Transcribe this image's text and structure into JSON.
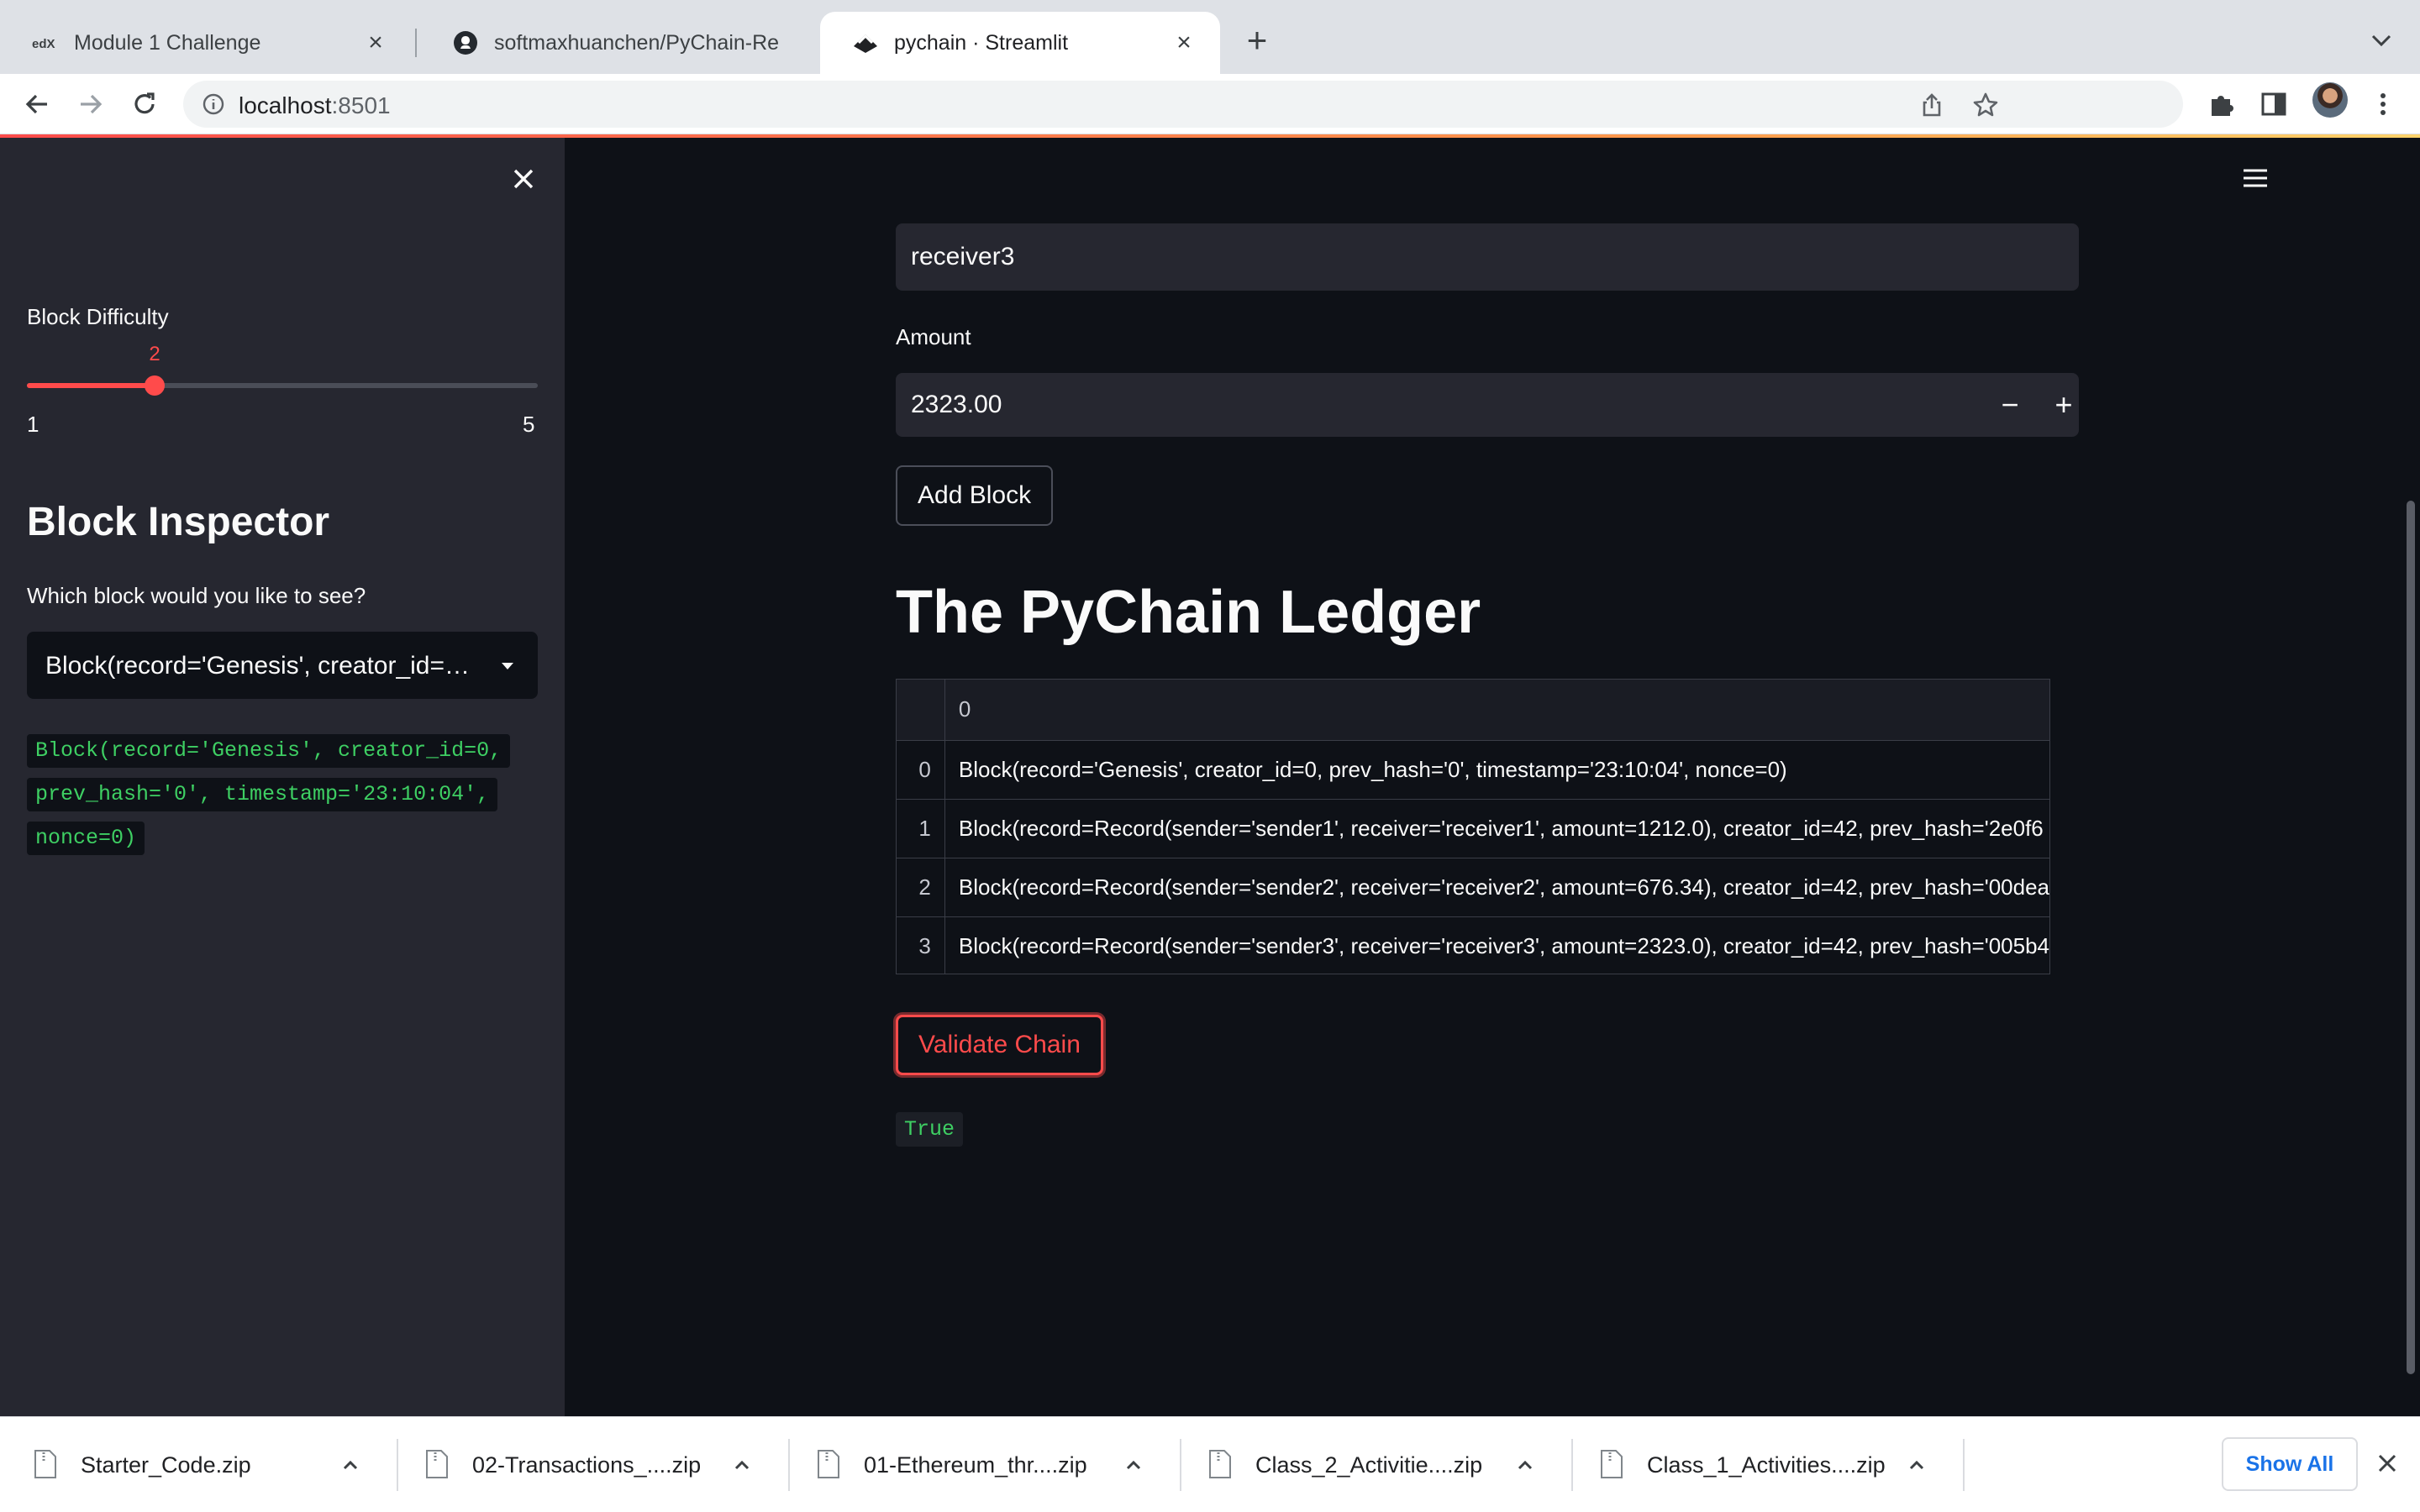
{
  "browser": {
    "tabs": [
      {
        "title": "Module 1 Challenge",
        "icon": "edx-icon"
      },
      {
        "title": "softmaxhuanchen/PyChain-Re",
        "icon": "github-icon"
      },
      {
        "title": "pychain · Streamlit",
        "icon": "streamlit-icon",
        "active": true
      }
    ],
    "url_host": "localhost",
    "url_port": ":8501"
  },
  "sidebar": {
    "difficulty_label": "Block Difficulty",
    "difficulty_value": "2",
    "difficulty_min": "1",
    "difficulty_max": "5",
    "difficulty_level": 0.25,
    "inspector_title": "Block Inspector",
    "inspector_question": "Which block would you like to see?",
    "selected_block": "Block(record='Genesis', creator_id=0, prev_hash='0', timestamp='23:10:04', nonce=0)",
    "block_code_lines": [
      "Block(record='Genesis', creator_id=0,",
      "prev_hash='0', timestamp='23:10:04',",
      "nonce=0)"
    ]
  },
  "main": {
    "receiver_value": "receiver3",
    "amount_label": "Amount",
    "amount_value": "2323.00",
    "stepper_minus": "−",
    "stepper_plus": "+",
    "add_block_label": "Add Block",
    "ledger_title": "The PyChain Ledger",
    "table": {
      "column_header": "0",
      "rows": [
        {
          "index": "0",
          "value": "Block(record='Genesis', creator_id=0, prev_hash='0', timestamp='23:10:04', nonce=0)"
        },
        {
          "index": "1",
          "value": "Block(record=Record(sender='sender1', receiver='receiver1', amount=1212.0), creator_id=42, prev_hash='2e0f6"
        },
        {
          "index": "2",
          "value": "Block(record=Record(sender='sender2', receiver='receiver2', amount=676.34), creator_id=42, prev_hash='00dea"
        },
        {
          "index": "3",
          "value": "Block(record=Record(sender='sender3', receiver='receiver3', amount=2323.0), creator_id=42, prev_hash='005b4"
        }
      ]
    },
    "validate_label": "Validate Chain",
    "validate_result": "True"
  },
  "downloads": {
    "items": [
      "Starter_Code.zip",
      "02-Transactions_....zip",
      "01-Ethereum_thr....zip",
      "Class_2_Activitie....zip",
      "Class_1_Activities....zip"
    ],
    "show_all_label": "Show All"
  },
  "colors": {
    "accent": "#ff4b4b",
    "sidebar_bg": "#262730",
    "main_bg": "#0e1117",
    "code_green": "#3ecf63",
    "link_blue": "#1a73e8"
  }
}
